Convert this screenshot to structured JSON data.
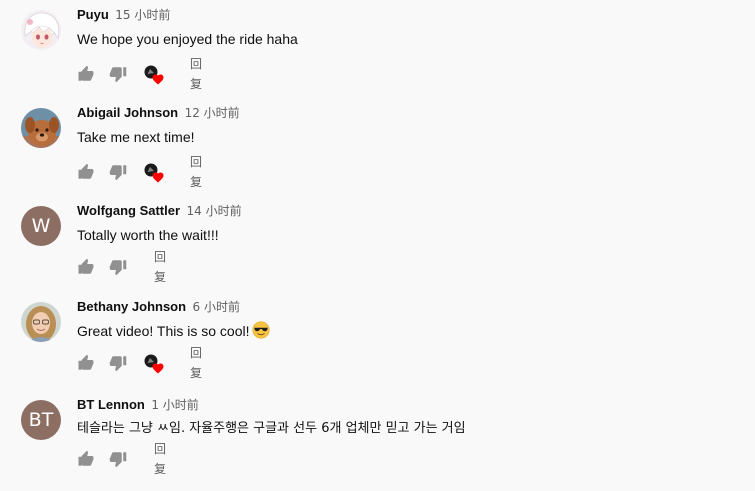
{
  "comments": [
    {
      "author": "Puyu",
      "time": "15 小时前",
      "text": "We hope you enjoyed the ride haha",
      "avatar": "anime-avatar-icon",
      "hearted": true,
      "reply_label": "回复"
    },
    {
      "author": "Abigail Johnson",
      "time": "12 小时前",
      "text": "Take me next time!",
      "avatar": "dog-photo-avatar-icon",
      "hearted": true,
      "reply_label": "回复"
    },
    {
      "author": "Wolfgang Sattler",
      "time": "14 小时前",
      "text": "Totally worth the wait!!!",
      "avatar_letter": "W",
      "hearted": false,
      "reply_label": "回复"
    },
    {
      "author": "Bethany Johnson",
      "time": "6 小时前",
      "text": "Great video! This is so cool!",
      "emoji": "sunglasses-emoji-icon",
      "avatar": "woman-photo-avatar-icon",
      "hearted": true,
      "reply_label": "回复"
    },
    {
      "author": "BT Lennon",
      "time": "1 小时前",
      "text": "테슬라는 그냥 ㅆ임. 자율주행은 구글과 선두 6개 업체만 믿고 가는 거임",
      "avatar_letter": "BT",
      "hearted": false,
      "reply_label": "回复"
    }
  ],
  "colors": {
    "background": "#f9f9f9",
    "icon_gray": "#909090",
    "heart_red": "#ff0000",
    "letter_avatar": "#8d6e63"
  }
}
